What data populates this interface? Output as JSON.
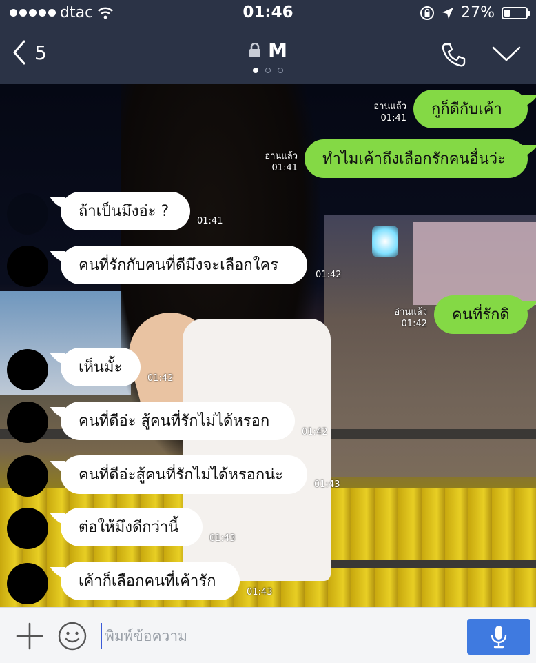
{
  "status_bar": {
    "carrier": "dtac",
    "time": "01:46",
    "battery_percent": "27%",
    "battery_level": 0.27,
    "icons": [
      "signal-dots",
      "wifi-icon",
      "rotation-lock-icon",
      "location-arrow-icon",
      "battery-icon"
    ]
  },
  "nav": {
    "back_count": "5",
    "title": "M",
    "title_icon": "lock-icon",
    "page_indicator_total": 3,
    "page_indicator_active": 1,
    "actions": [
      "phone-icon",
      "chevron-down-icon"
    ]
  },
  "messages": [
    {
      "side": "out",
      "text": "กูก็ดีกับเค้า",
      "read": "อ่านแล้ว",
      "time": "01:41"
    },
    {
      "side": "out",
      "text": "ทำไมเค้าถึงเลือกรักคนอื่นว่ะ",
      "read": "อ่านแล้ว",
      "time": "01:41"
    },
    {
      "side": "in",
      "text": "ถ้าเป็นมึงอ่ะ ?",
      "time": "01:41"
    },
    {
      "side": "in",
      "text": "คนที่รักกับคนที่ดีมึงจะเลือกใคร",
      "time": "01:42"
    },
    {
      "side": "out",
      "text": "คนที่รักดิ",
      "read": "อ่านแล้ว",
      "time": "01:42"
    },
    {
      "side": "in",
      "text": "เห็นมั้ะ",
      "time": "01:42"
    },
    {
      "side": "in",
      "text": "คนที่ดีอ่ะ สู้คนที่รักไม่ได้หรอก",
      "time": "01:42"
    },
    {
      "side": "in",
      "text": "คนที่ดีอ่ะสู้คนที่รักไม่ได้หรอกน่ะ",
      "time": "01:43"
    },
    {
      "side": "in",
      "text": "ต่อให้มึงดีกว่านี้",
      "time": "01:43"
    },
    {
      "side": "in",
      "text": "เค้าก็เลือกคนที่เค้ารัก",
      "time": "01:43"
    }
  ],
  "input": {
    "placeholder": "พิมพ์ข้อความ",
    "value": ""
  },
  "colors": {
    "header_bg": "#2b3346",
    "outgoing_bubble": "#84d945",
    "incoming_bubble": "#ffffff",
    "mic_button": "#3f7ae0"
  }
}
